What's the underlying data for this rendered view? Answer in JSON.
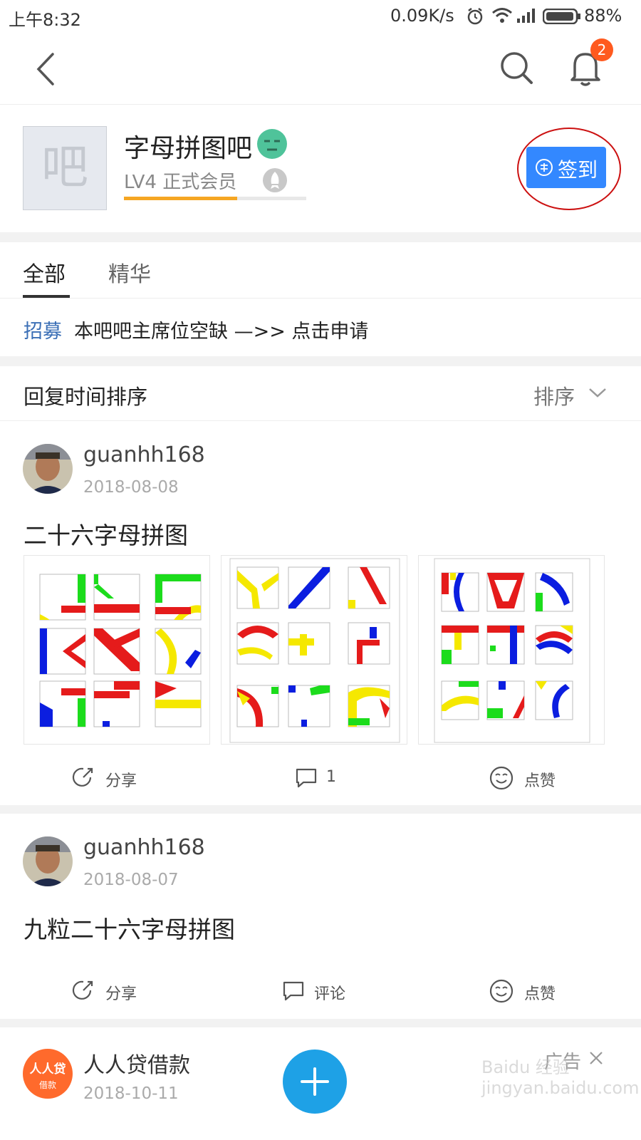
{
  "status_bar": {
    "time": "上午8:32",
    "net_speed": "0.09K/s",
    "battery": "88%",
    "icons": [
      "alarm-icon",
      "wifi-icon",
      "signal-icon",
      "battery-icon"
    ]
  },
  "top_bar": {
    "notification_count": "2",
    "icons": [
      "back-arrow-icon",
      "search-icon",
      "bell-icon"
    ]
  },
  "forum": {
    "avatar_char": "吧",
    "name": "字母拼图吧",
    "level_text": "LV4 正式会员",
    "level_progress": 0.62,
    "sign_in_label": "签到"
  },
  "tabs": [
    {
      "label": "全部",
      "active": true
    },
    {
      "label": "精华",
      "active": false
    }
  ],
  "notice": {
    "tag": "招募",
    "text": "本吧吧主席位空缺 —>> 点击申请"
  },
  "sort": {
    "label": "回复时间排序",
    "button": "排序"
  },
  "posts": [
    {
      "user": "guanhh168",
      "date": "2018-08-08",
      "title": "二十六字母拼图",
      "share": "分享",
      "comment": "1",
      "like": "点赞"
    },
    {
      "user": "guanhh168",
      "date": "2018-08-07",
      "title": "九粒二十六字母拼图",
      "share": "分享",
      "comment": "评论",
      "like": "点赞"
    }
  ],
  "ad": {
    "name": "人人贷借款",
    "date": "2018-10-11",
    "tag": "广告",
    "logo_text_top": "人人贷",
    "logo_text_bottom": "借款"
  },
  "watermark": "Baidu 经验 jingyan.baidu.com",
  "colors": {
    "accent_blue": "#3388ff",
    "fab_blue": "#1ea1e6",
    "badge_orange": "#ff5a1f",
    "progress_orange": "#f5a623",
    "notice_blue": "#3b6fb6",
    "annotation_red": "#cc1111",
    "ad_orange": "#ff6a2c"
  }
}
